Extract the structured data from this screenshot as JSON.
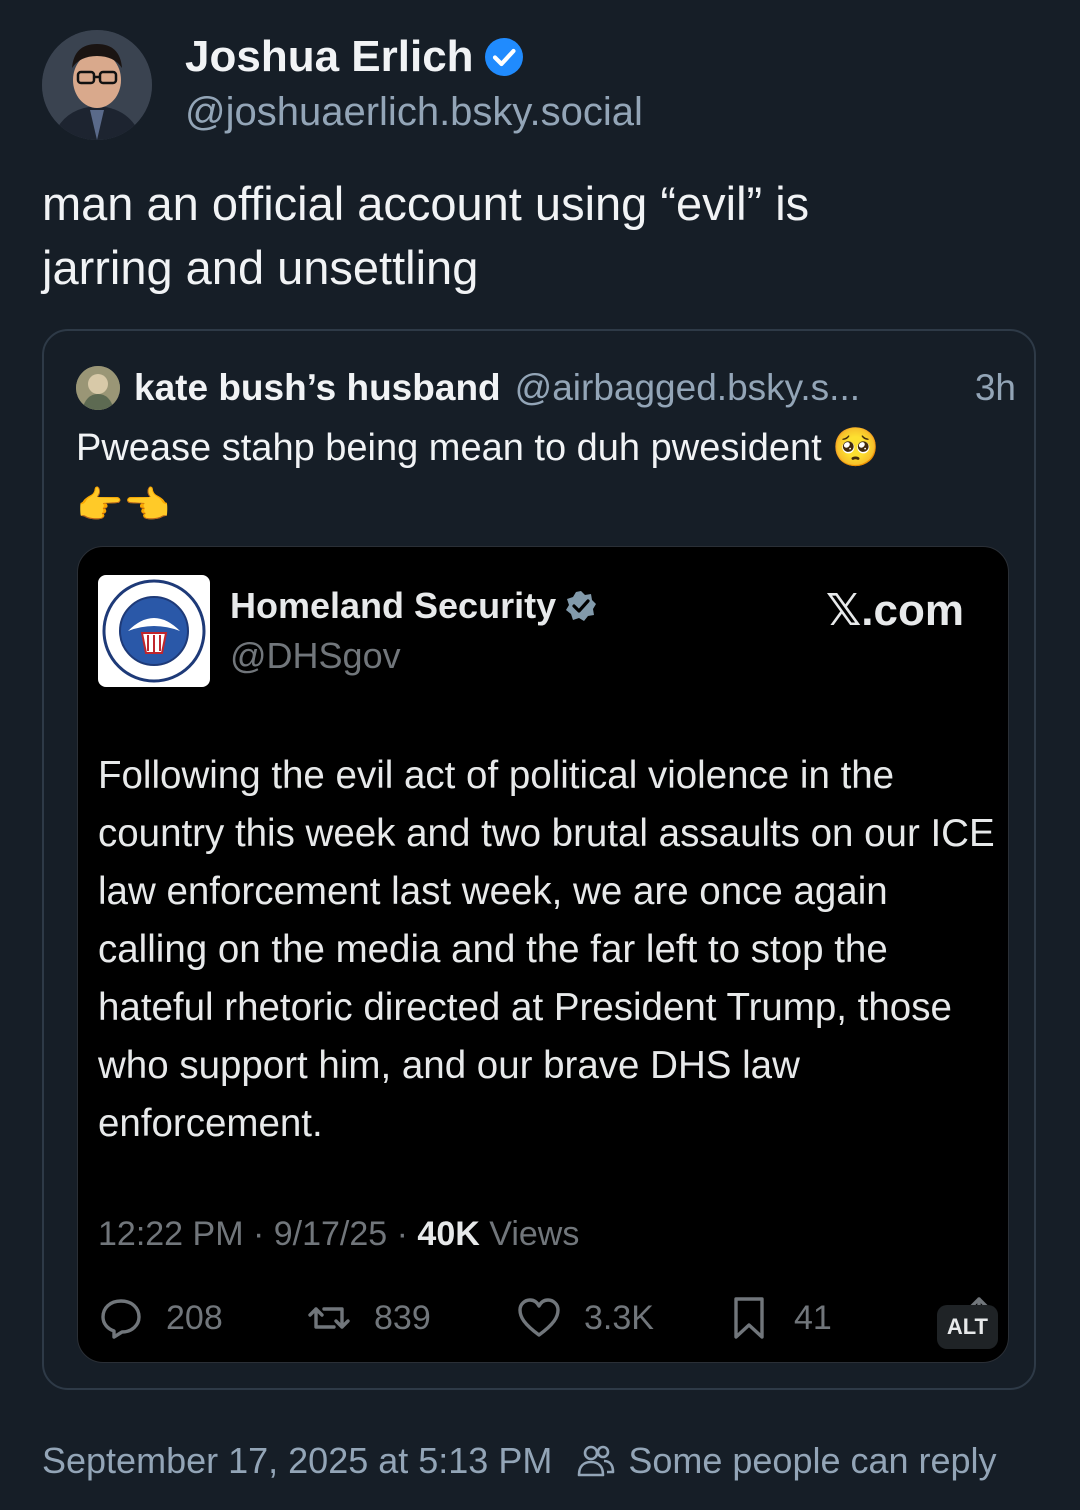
{
  "post": {
    "author_name": "Joshua Erlich",
    "author_handle": "@joshuaerlich.bsky.social",
    "text_line1": "man an official account using “evil” is",
    "text_line2": "jarring and unsettling",
    "timestamp": "September 17, 2025 at 5:13 PM",
    "reply_setting": "Some people can reply"
  },
  "quote": {
    "author_name": "kate bush’s husband",
    "author_handle": "@airbagged.bsky.s...",
    "age": "3h",
    "text": "Pwease stahp being mean to duh pwesident 🥺",
    "emoji_line": "👉👈"
  },
  "embedded_tweet": {
    "account_name": "Homeland Security",
    "account_handle": "@DHSgov",
    "source": "𝕏.com",
    "body": "Following the evil act of political violence in the country this week and two brutal assaults on our ICE law enforcement last week, we are once again calling on the media and the far left to stop the hateful rhetoric directed at President Trump, those who support him, and our brave DHS law enforcement.",
    "time": "12:22 PM",
    "date": "9/17/25",
    "views_count": "40K",
    "views_label": "Views",
    "replies": "208",
    "reposts": "839",
    "likes": "3.3K",
    "bookmarks": "41",
    "alt_badge": "ALT"
  },
  "colors": {
    "background": "#161e27",
    "muted": "#93a5b7",
    "verified_blue": "#208bfe"
  }
}
